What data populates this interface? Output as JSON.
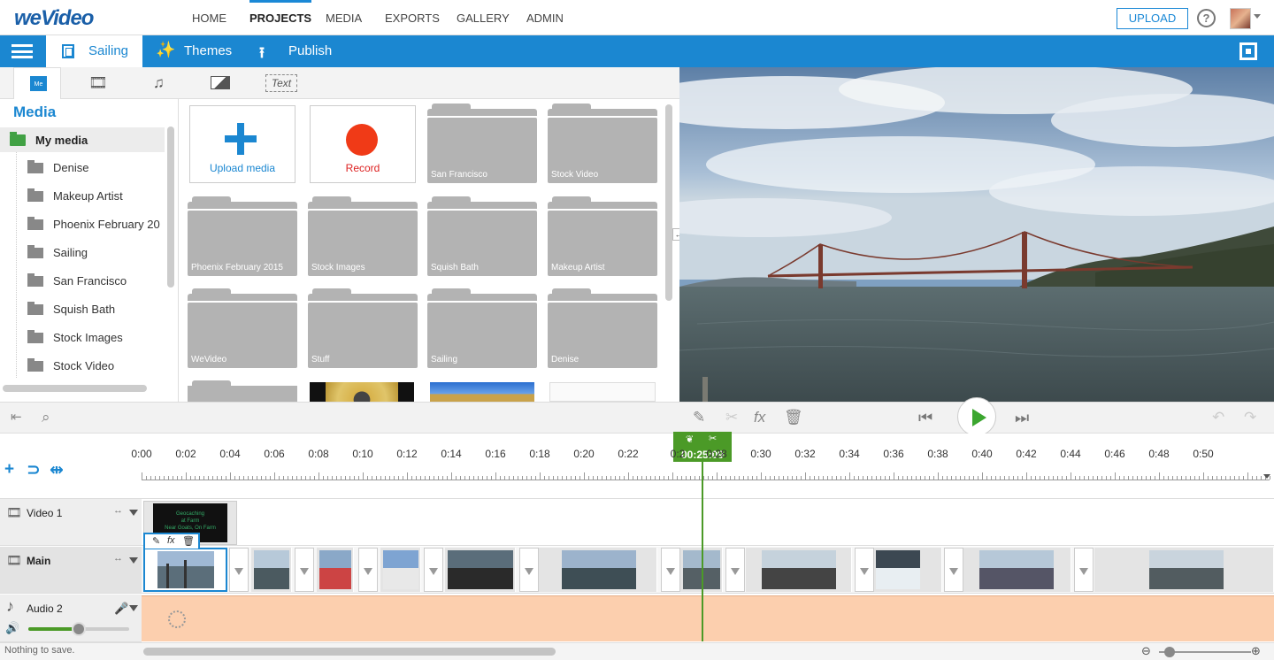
{
  "app": {
    "logo": "weVideo",
    "nav": [
      "HOME",
      "PROJECTS",
      "MEDIA",
      "EXPORTS",
      "GALLERY",
      "ADMIN"
    ],
    "active_nav": "PROJECTS",
    "upload_label": "UPLOAD",
    "help_label": "?"
  },
  "project_bar": {
    "project_tab": "Sailing",
    "themes_label": "Themes",
    "publish_label": "Publish"
  },
  "media_tabs": {
    "media_icon_text": "Me",
    "text_tab_label": "Text"
  },
  "media_panel": {
    "heading": "Media",
    "root": "My media",
    "folders": [
      "Denise",
      "Makeup Artist",
      "Phoenix February 20",
      "Sailing",
      "San Francisco",
      "Squish Bath",
      "Stock Images",
      "Stock Video"
    ],
    "upload_tile": "Upload media",
    "record_tile": "Record",
    "grid_folders": [
      "San Francisco",
      "Stock Video",
      "Phoenix February 2015",
      "Stock Images",
      "Squish Bath",
      "Makeup Artist",
      "WeVideo",
      "Stuff",
      "Sailing",
      "Denise"
    ]
  },
  "timeline": {
    "ticks": [
      "0:00",
      "0:02",
      "0:04",
      "0:06",
      "0:08",
      "0:10",
      "0:12",
      "0:14",
      "0:16",
      "0:18",
      "0:20",
      "0:22",
      "0:2",
      "0:28",
      "0:30",
      "0:32",
      "0:34",
      "0:36",
      "0:38",
      "0:40",
      "0:42",
      "0:44",
      "0:46",
      "0:48",
      "0:50"
    ],
    "playhead_time": "00:25:09",
    "tracks": [
      "Video 1",
      "Main",
      "Audio 2"
    ],
    "clip_fx_label": "fx",
    "video1_clip_text": "Geocaching\nat Farm\nNear Goats, On Farm"
  },
  "audio": {
    "volume_fraction": 0.5
  },
  "status": {
    "message": "Nothing to save."
  },
  "colors": {
    "accent": "#1b87d1",
    "playhead": "#4b9a27",
    "audio_track": "#fccfae"
  }
}
